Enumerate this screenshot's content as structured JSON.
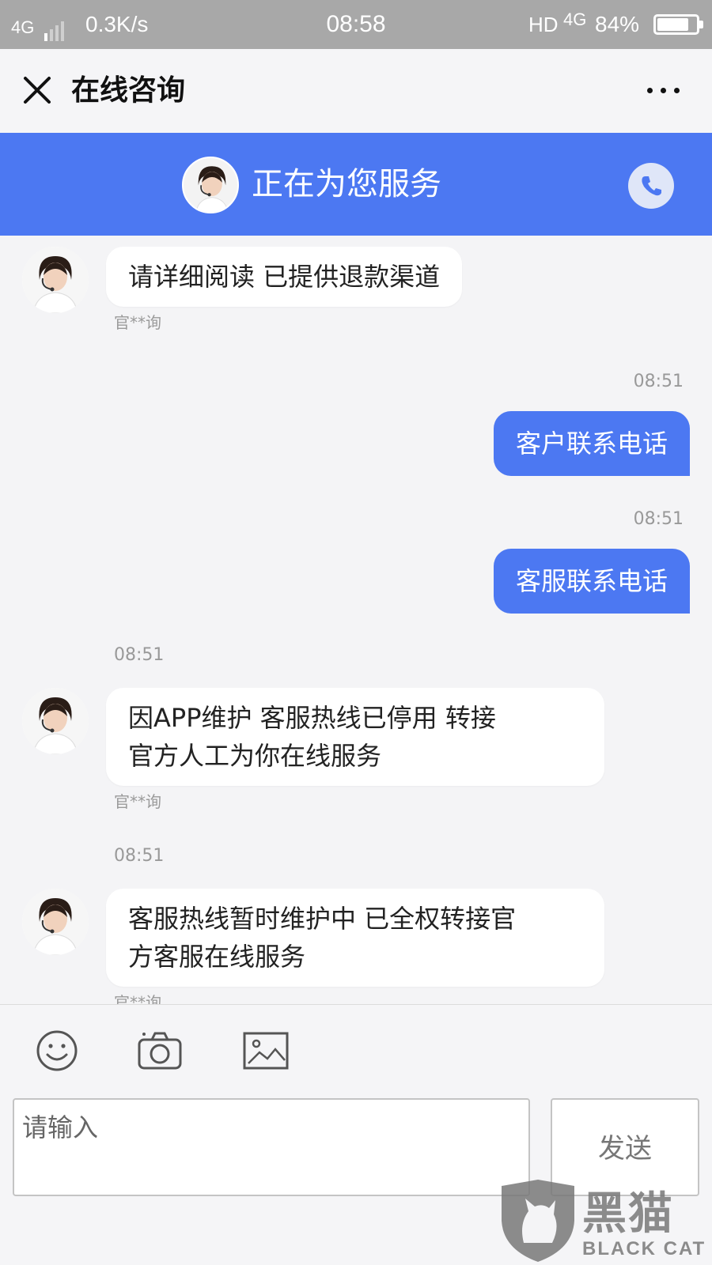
{
  "status_bar": {
    "network": "4G",
    "speed": "0.3K/s",
    "time": "08:58",
    "hd": "HD",
    "network2": "4G",
    "battery": "84%",
    "battery_level": 0.84
  },
  "header": {
    "title": "在线咨询"
  },
  "banner": {
    "text": "正在为您服务"
  },
  "messages": [
    {
      "side": "in",
      "text": "请详细阅读 已提供退款渠道",
      "sender": "官**询"
    },
    {
      "side": "out",
      "time": "08:51",
      "text": "客户联系电话"
    },
    {
      "side": "out",
      "time": "08:51",
      "text": "客服联系电话"
    },
    {
      "side": "in",
      "time": "08:51",
      "lines": [
        "因APP维护 客服热线已停用 转接",
        "官方人工为你在线服务"
      ],
      "sender": "官**询"
    },
    {
      "side": "in",
      "time": "08:51",
      "lines": [
        "客服热线暂时维护中 已全权转接官",
        "方客服在线服务"
      ],
      "sender": "官**询"
    }
  ],
  "input": {
    "placeholder": "请输入",
    "send_label": "发送"
  },
  "watermark": {
    "title": "黑猫",
    "subtitle": "BLACK CAT"
  },
  "colors": {
    "accent": "#4c78f2",
    "status_bar": "#a8a8a8"
  },
  "icons": [
    "close-icon",
    "more-icon",
    "phone-icon",
    "emoji-icon",
    "camera-icon",
    "image-icon"
  ]
}
